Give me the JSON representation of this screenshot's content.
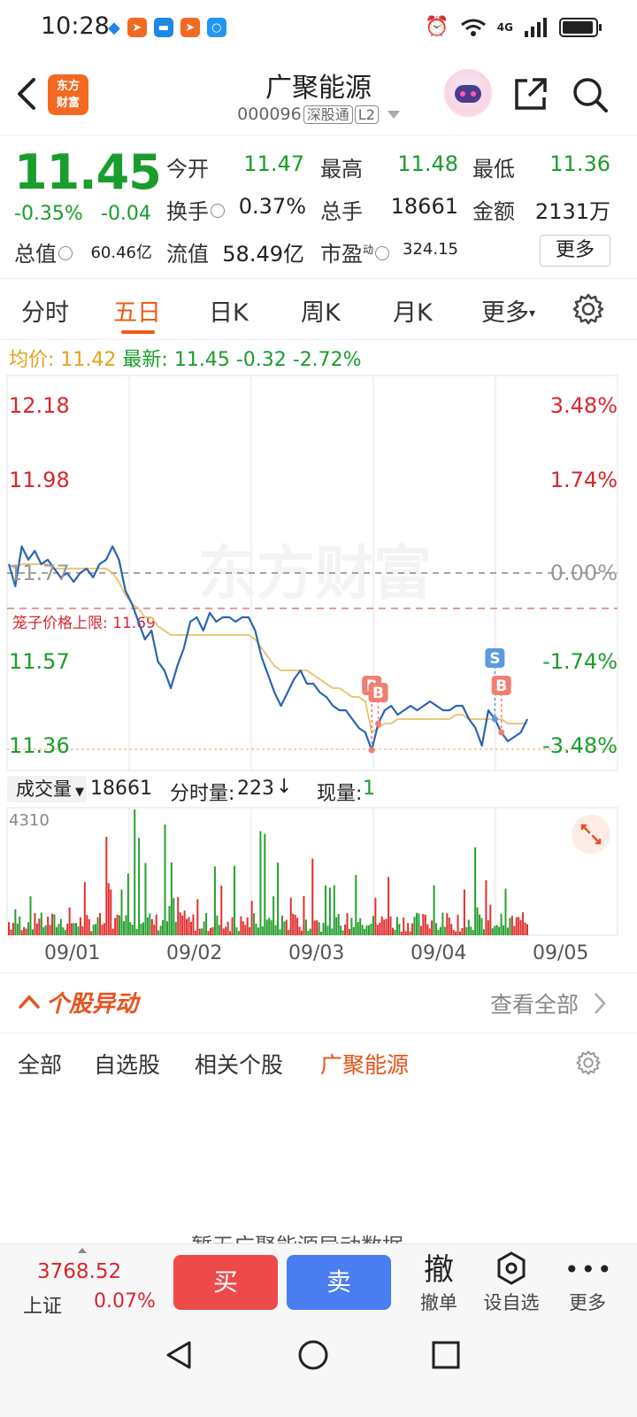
{
  "status": {
    "time": "10:28",
    "network": "4G"
  },
  "header": {
    "logo_line1": "东方",
    "logo_line2": "财富",
    "title": "广聚能源",
    "code": "000096",
    "tag1": "深股通",
    "tag2": "L2"
  },
  "quote": {
    "price": "11.45",
    "change_pct": "-0.35%",
    "change": "-0.04",
    "open_label": "今开",
    "open": "11.47",
    "high_label": "最高",
    "high": "11.48",
    "low_label": "最低",
    "low": "11.36",
    "turnover_label": "换手",
    "turnover": "0.37%",
    "volume_label": "总手",
    "volume": "18661",
    "amount_label": "金额",
    "amount": "2131万",
    "mcap_label": "总值",
    "mcap": "60.46亿",
    "float_label": "流值",
    "float_cap": "58.49亿",
    "pe_label": "市盈",
    "pe_sup": "动",
    "pe": "324.15",
    "more": "更多"
  },
  "tabs": [
    "分时",
    "五日",
    "日K",
    "周K",
    "月K",
    "更多"
  ],
  "active_tab": "五日",
  "info_line": {
    "avg_label": "均价:",
    "avg": "11.42",
    "latest_label": "最新:",
    "latest": "11.45",
    "chg": "-0.32",
    "pct": "-2.72%"
  },
  "chart_data": {
    "type": "line",
    "y_left_ticks": [
      "12.18",
      "11.98",
      "11.77",
      "11.57",
      "11.36"
    ],
    "y_right_ticks": [
      "3.48%",
      "1.74%",
      "0.00%",
      "-1.74%",
      "-3.48%"
    ],
    "ylim": [
      11.36,
      12.18
    ],
    "reference": 11.77,
    "cage_limit_label": "笼子价格上限:",
    "cage_limit": "11.69",
    "watermark": "东方财富",
    "x_labels": [
      "09/01",
      "09/02",
      "09/03",
      "09/04",
      "09/05"
    ],
    "series": [
      {
        "name": "最新",
        "color": "#2a64b5",
        "values": [
          11.79,
          11.74,
          11.83,
          11.8,
          11.82,
          11.79,
          11.8,
          11.78,
          11.76,
          11.77,
          11.75,
          11.77,
          11.78,
          11.76,
          11.79,
          11.8,
          11.83,
          11.8,
          11.73,
          11.7,
          11.66,
          11.62,
          11.64,
          11.57,
          11.55,
          11.51,
          11.56,
          11.6,
          11.66,
          11.67,
          11.64,
          11.68,
          11.66,
          11.67,
          11.67,
          11.66,
          11.67,
          11.67,
          11.64,
          11.58,
          11.54,
          11.5,
          11.47,
          11.5,
          11.53,
          11.55,
          11.52,
          11.52,
          11.5,
          11.49,
          11.47,
          11.46,
          11.46,
          11.44,
          11.42,
          11.41,
          11.37,
          11.43,
          11.46,
          11.47,
          11.45,
          11.46,
          11.47,
          11.46,
          11.47,
          11.48,
          11.47,
          11.46,
          11.46,
          11.47,
          11.47,
          11.44,
          11.42,
          11.38,
          11.46,
          11.44,
          11.41,
          11.39,
          11.4,
          11.41,
          11.44
        ]
      },
      {
        "name": "均价",
        "color": "#e9c06a",
        "values": [
          11.79,
          11.78,
          11.79,
          11.79,
          11.79,
          11.79,
          11.79,
          11.78,
          11.78,
          11.78,
          11.78,
          11.78,
          11.78,
          11.78,
          11.78,
          11.78,
          11.77,
          11.75,
          11.72,
          11.7,
          11.69,
          11.67,
          11.67,
          11.65,
          11.64,
          11.63,
          11.63,
          11.63,
          11.63,
          11.63,
          11.63,
          11.63,
          11.63,
          11.63,
          11.63,
          11.63,
          11.63,
          11.63,
          11.62,
          11.6,
          11.58,
          11.56,
          11.55,
          11.55,
          11.55,
          11.55,
          11.55,
          11.54,
          11.53,
          11.52,
          11.51,
          11.51,
          11.5,
          11.49,
          11.49,
          11.48,
          11.41,
          11.42,
          11.43,
          11.43,
          11.44,
          11.44,
          11.44,
          11.44,
          11.44,
          11.44,
          11.44,
          11.44,
          11.44,
          11.45,
          11.45,
          11.44,
          11.44,
          11.44,
          11.44,
          11.44,
          11.44,
          11.43,
          11.43,
          11.43,
          11.43
        ]
      }
    ],
    "markers": [
      {
        "label": "B",
        "index": 56,
        "color": "#f07f72"
      },
      {
        "label": "B",
        "index": 57,
        "color": "#f07f72"
      },
      {
        "label": "S",
        "index": 75,
        "color": "#5a9ae0"
      },
      {
        "label": "B",
        "index": 76,
        "color": "#f07f72"
      }
    ],
    "volume": {
      "max_label": "4310",
      "total_label": "成交量",
      "total": "18661",
      "tick_label": "分时量:",
      "tick": "223",
      "now_label": "现量:",
      "now": "1"
    }
  },
  "section": {
    "title": "个股异动",
    "view_all": "查看全部"
  },
  "sub_tabs": [
    "全部",
    "自选股",
    "相关个股",
    "广聚能源"
  ],
  "active_sub_tab": "广聚能源",
  "cut_text": "暂无广聚能源异动数据",
  "bottom_bar": {
    "index_value": "3768.52",
    "index_name": "上证",
    "index_pct": "0.07%",
    "buy": "买",
    "sell": "卖",
    "cancel_big": "撤",
    "cancel": "撤单",
    "watch": "设自选",
    "more": "更多"
  },
  "colors": {
    "up": "#d9262c",
    "down": "#1a9d2c",
    "accent": "#f05a1a",
    "buy": "#ee4a4a",
    "sell": "#4a7df0"
  }
}
